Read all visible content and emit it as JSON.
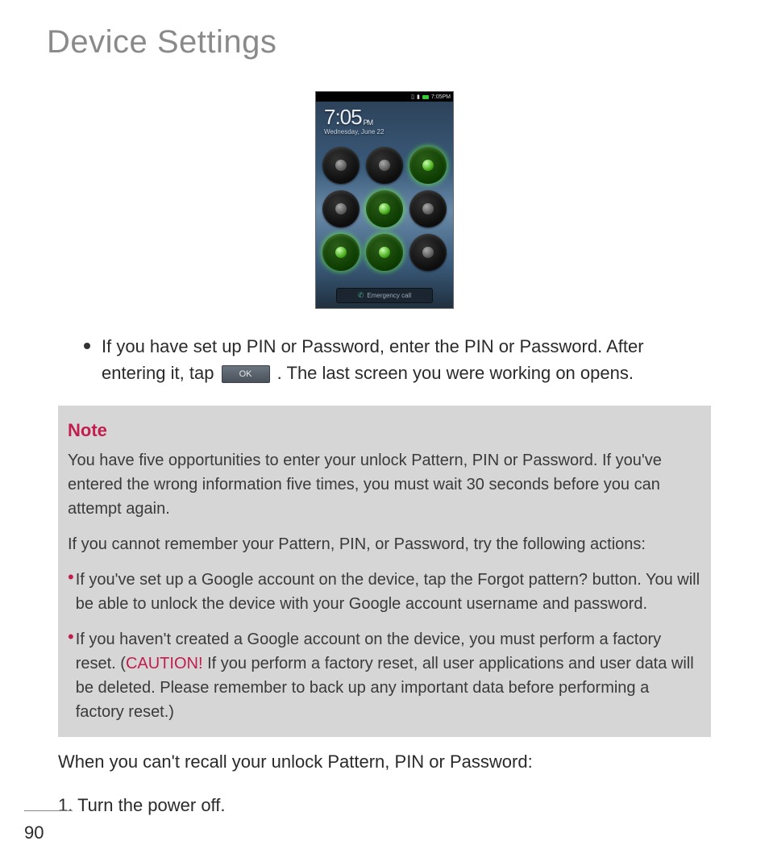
{
  "title": "Device Settings",
  "phone": {
    "status_time": "7:05PM",
    "clock": "7:05",
    "ampm": "PM",
    "date": "Wednesday, June 22",
    "emergency_label": "Emergency call",
    "active_nodes": [
      2,
      4,
      6,
      7
    ]
  },
  "main_bullet": {
    "part1": "If you have set up PIN or Password, enter the PIN or Password. After entering it, tap ",
    "ok_label": "OK",
    "part2": ". The last screen you were working on opens."
  },
  "note": {
    "heading": "Note",
    "p1": "You have five opportunities to enter your unlock Pattern, PIN or Password. If you've entered the wrong information five times, you must wait 30 seconds before you can attempt again.",
    "p2": "If you cannot remember your Pattern, PIN, or Password, try the following actions:",
    "b1": "If you've set up a Google account on the device, tap the Forgot pattern? button. You will be able to unlock the device with your Google account username and password.",
    "b2a": "If you haven't created a Google account on the device, you must perform a factory reset. (",
    "caution": "CAUTION!",
    "b2b": " If you perform a factory reset, all user applications and user data will be deleted. Please remember to back up any important data before performing a factory reset.)"
  },
  "after": {
    "heading": "When you can't recall your unlock Pattern, PIN or Password:",
    "step1": "1. Turn the power off."
  },
  "page_number": "90"
}
